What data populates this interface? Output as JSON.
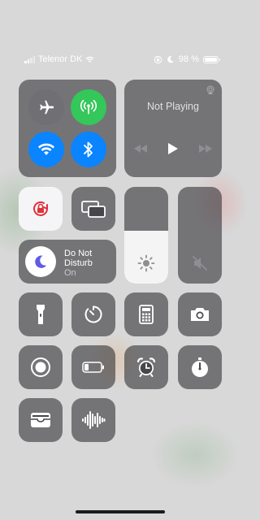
{
  "status_bar": {
    "carrier": "Telenor DK",
    "battery_text": "98 %",
    "battery_level": 0.98,
    "signal_bars": 2,
    "icons": [
      "cellular-signal-icon",
      "wifi-icon",
      "rotation-lock-icon",
      "moon-icon",
      "battery-icon"
    ]
  },
  "connectivity": {
    "airplane_mode": false,
    "cellular_data": true,
    "wifi": true,
    "bluetooth": true
  },
  "now_playing": {
    "title": "Not Playing"
  },
  "orientation_lock": {
    "enabled": true
  },
  "do_not_disturb": {
    "title": "Do Not Disturb",
    "state": "On"
  },
  "brightness": {
    "level": 0.55
  },
  "volume": {
    "level": 0.0,
    "muted": true
  },
  "controls": [
    "flashlight",
    "timer",
    "calculator",
    "camera",
    "screen-recording",
    "low-power-mode",
    "alarm",
    "stopwatch",
    "wallet",
    "voice-memos"
  ],
  "colors": {
    "green": "#34c759",
    "blue": "#0a84ff",
    "orientation_red": "#e0303a",
    "dnd_purple": "#5e5ce6"
  }
}
